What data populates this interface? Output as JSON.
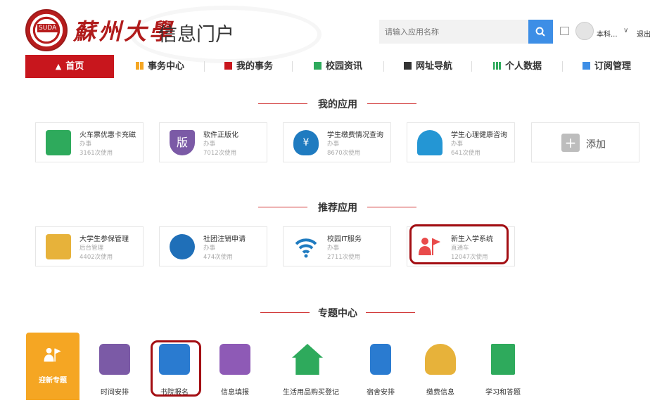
{
  "header": {
    "logo_text": "蘇州大學",
    "portal_title": "信息门户",
    "search": {
      "placeholder": "请输入应用名称",
      "value": ""
    },
    "user_name": "本科...",
    "logout": "退出"
  },
  "nav": {
    "items": [
      {
        "label": "首页",
        "icon": "home-icon",
        "color": "#ffffff"
      },
      {
        "label": "事务中心",
        "icon": "grid-icon",
        "color": "#f5a623"
      },
      {
        "label": "我的事务",
        "icon": "bookmark-icon",
        "color": "#c8161d"
      },
      {
        "label": "校园资讯",
        "icon": "mail-icon",
        "color": "#2eaa5c"
      },
      {
        "label": "网址导航",
        "icon": "browser-icon",
        "color": "#333333"
      },
      {
        "label": "个人数据",
        "icon": "bar-chart-icon",
        "color": "#2eaa5c"
      },
      {
        "label": "订阅管理",
        "icon": "subscribe-icon",
        "color": "#3d8ee6"
      }
    ]
  },
  "my_apps": {
    "title": "我的应用",
    "items": [
      {
        "name": "火车票优惠卡充磁",
        "type": "办事",
        "usage": "3161次使用",
        "color": "#2eaa5c"
      },
      {
        "name": "软件正版化",
        "type": "办事",
        "usage": "7012次使用",
        "color": "#7b5aa6"
      },
      {
        "name": "学生缴费情况查询",
        "type": "办事",
        "usage": "8670次使用",
        "color": "#1f7bc0"
      },
      {
        "name": "学生心理健康咨询",
        "type": "办事",
        "usage": "641次使用",
        "color": "#2496d4"
      }
    ],
    "add_label": "添加"
  },
  "recommended": {
    "title": "推荐应用",
    "items": [
      {
        "name": "大学生参保管理",
        "type": "后台管理",
        "usage": "4402次使用",
        "color": "#e7b23a"
      },
      {
        "name": "社团注销申请",
        "type": "办事",
        "usage": "474次使用",
        "color": "#1f6fb8"
      },
      {
        "name": "校园IT服务",
        "type": "办事",
        "usage": "2711次使用",
        "color": "#1f7bc0"
      },
      {
        "name": "新生入学系统",
        "type": "直通车",
        "usage": "12047次使用",
        "color": "#e94b4b"
      }
    ]
  },
  "topics": {
    "title": "专题中心",
    "items": [
      {
        "label": "迎新专题",
        "color": "#f5a623"
      },
      {
        "label": "时间安排",
        "color": "#7b5aa6"
      },
      {
        "label": "书院报名",
        "color": "#2a7bd0"
      },
      {
        "label": "信息填报",
        "color": "#8e5ab6"
      },
      {
        "label": "生活用品购买登记",
        "color": "#2eaa5c"
      },
      {
        "label": "宿舍安排",
        "color": "#2a7bd0"
      },
      {
        "label": "缴费信息",
        "color": "#e7b23a"
      },
      {
        "label": "学习和答题",
        "color": "#2eaa5c"
      }
    ]
  }
}
